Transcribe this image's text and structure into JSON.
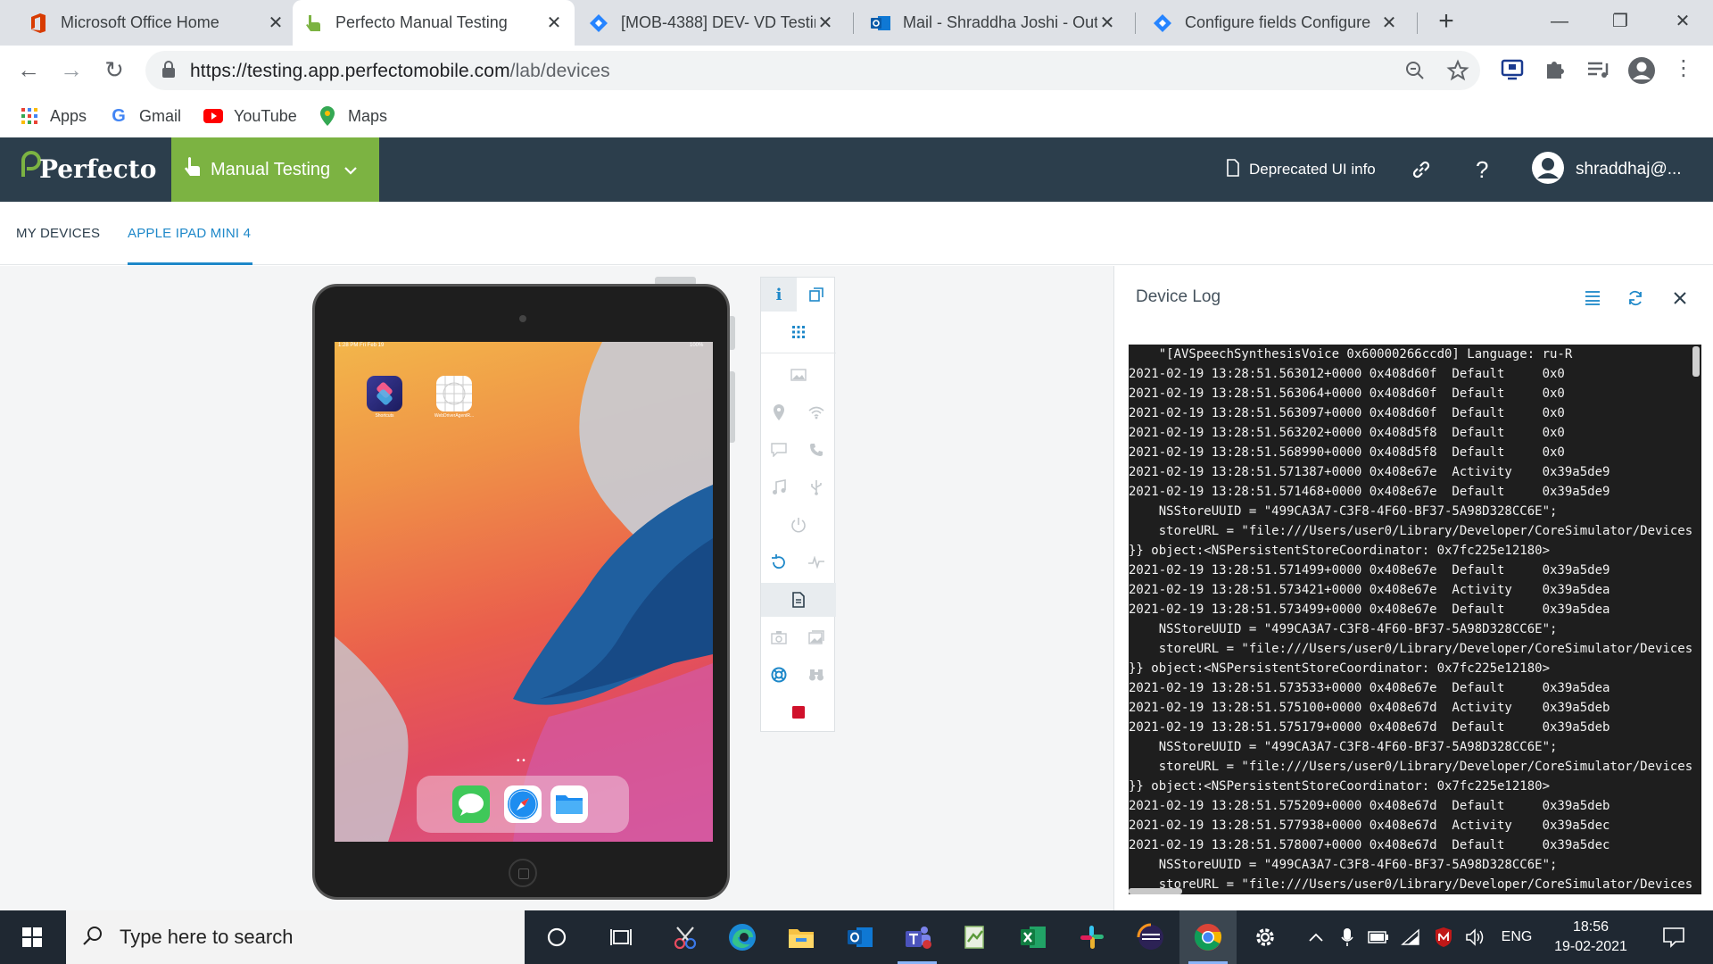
{
  "browser": {
    "tabs": [
      {
        "title": "Microsoft Office Home",
        "icon": "office-icon"
      },
      {
        "title": "Perfecto Manual Testing",
        "icon": "perfecto-hand-icon",
        "active": true
      },
      {
        "title": "[MOB-4388] DEV- VD Testin",
        "icon": "jira-icon"
      },
      {
        "title": "Mail - Shraddha Joshi - Out",
        "icon": "outlook-icon"
      },
      {
        "title": "Configure fields Configure",
        "icon": "jira-icon"
      }
    ],
    "url_host": "https://testing.app.perfectomobile.com",
    "url_path": "/lab/devices",
    "bookmarks": [
      "Apps",
      "Gmail",
      "YouTube",
      "Maps"
    ]
  },
  "header": {
    "logo": "Perfecto",
    "product": "Manual Testing",
    "deprecated_info": "Deprecated UI info",
    "help": "?",
    "user": "shraddhaj@..."
  },
  "subnav": {
    "tabs": [
      "MY DEVICES",
      "APPLE IPAD MINI 4"
    ],
    "active_tab": "APPLE IPAD MINI 4"
  },
  "device": {
    "status_time": "1:28 PM  Fri Feb 19",
    "battery": "100%",
    "apps": [
      {
        "label": "Shortcuts"
      },
      {
        "label": "WebDriverAgentR..."
      }
    ],
    "dock": [
      "Messages",
      "Safari",
      "Files"
    ]
  },
  "device_log": {
    "title": "Device Log",
    "lines": [
      "    \"[AVSpeechSynthesisVoice 0x60000266ccd0] Language: ru-R",
      "2021-02-19 13:28:51.563012+0000 0x408d60f  Default     0x0",
      "2021-02-19 13:28:51.563064+0000 0x408d60f  Default     0x0",
      "2021-02-19 13:28:51.563097+0000 0x408d60f  Default     0x0",
      "2021-02-19 13:28:51.563202+0000 0x408d5f8  Default     0x0",
      "2021-02-19 13:28:51.568990+0000 0x408d5f8  Default     0x0",
      "2021-02-19 13:28:51.571387+0000 0x408e67e  Activity    0x39a5de9",
      "2021-02-19 13:28:51.571468+0000 0x408e67e  Default     0x39a5de9",
      "    NSStoreUUID = \"499CA3A7-C3F8-4F60-BF37-5A98D328CC6E\";",
      "    storeURL = \"file:///Users/user0/Library/Developer/CoreSimulator/Devices",
      "}} object:<NSPersistentStoreCoordinator: 0x7fc225e12180>",
      "2021-02-19 13:28:51.571499+0000 0x408e67e  Default     0x39a5de9",
      "2021-02-19 13:28:51.573421+0000 0x408e67e  Activity    0x39a5dea",
      "2021-02-19 13:28:51.573499+0000 0x408e67e  Default     0x39a5dea",
      "    NSStoreUUID = \"499CA3A7-C3F8-4F60-BF37-5A98D328CC6E\";",
      "    storeURL = \"file:///Users/user0/Library/Developer/CoreSimulator/Devices",
      "}} object:<NSPersistentStoreCoordinator: 0x7fc225e12180>",
      "2021-02-19 13:28:51.573533+0000 0x408e67e  Default     0x39a5dea",
      "2021-02-19 13:28:51.575100+0000 0x408e67d  Activity    0x39a5deb",
      "2021-02-19 13:28:51.575179+0000 0x408e67d  Default     0x39a5deb",
      "    NSStoreUUID = \"499CA3A7-C3F8-4F60-BF37-5A98D328CC6E\";",
      "    storeURL = \"file:///Users/user0/Library/Developer/CoreSimulator/Devices",
      "}} object:<NSPersistentStoreCoordinator: 0x7fc225e12180>",
      "2021-02-19 13:28:51.575209+0000 0x408e67d  Default     0x39a5deb",
      "2021-02-19 13:28:51.577938+0000 0x408e67d  Activity    0x39a5dec",
      "2021-02-19 13:28:51.578007+0000 0x408e67d  Default     0x39a5dec",
      "    NSStoreUUID = \"499CA3A7-C3F8-4F60-BF37-5A98D328CC6E\";",
      "    storeURL = \"file:///Users/user0/Library/Developer/CoreSimulator/Devices"
    ]
  },
  "taskbar": {
    "search_placeholder": "Type here to search",
    "language": "ENG",
    "time": "18:56",
    "date": "19-02-2021"
  },
  "colors": {
    "header_bg": "#2c3e4c",
    "accent_green": "#7cb342",
    "accent_blue": "#1e88c9",
    "log_bg": "#1e1e1e"
  }
}
